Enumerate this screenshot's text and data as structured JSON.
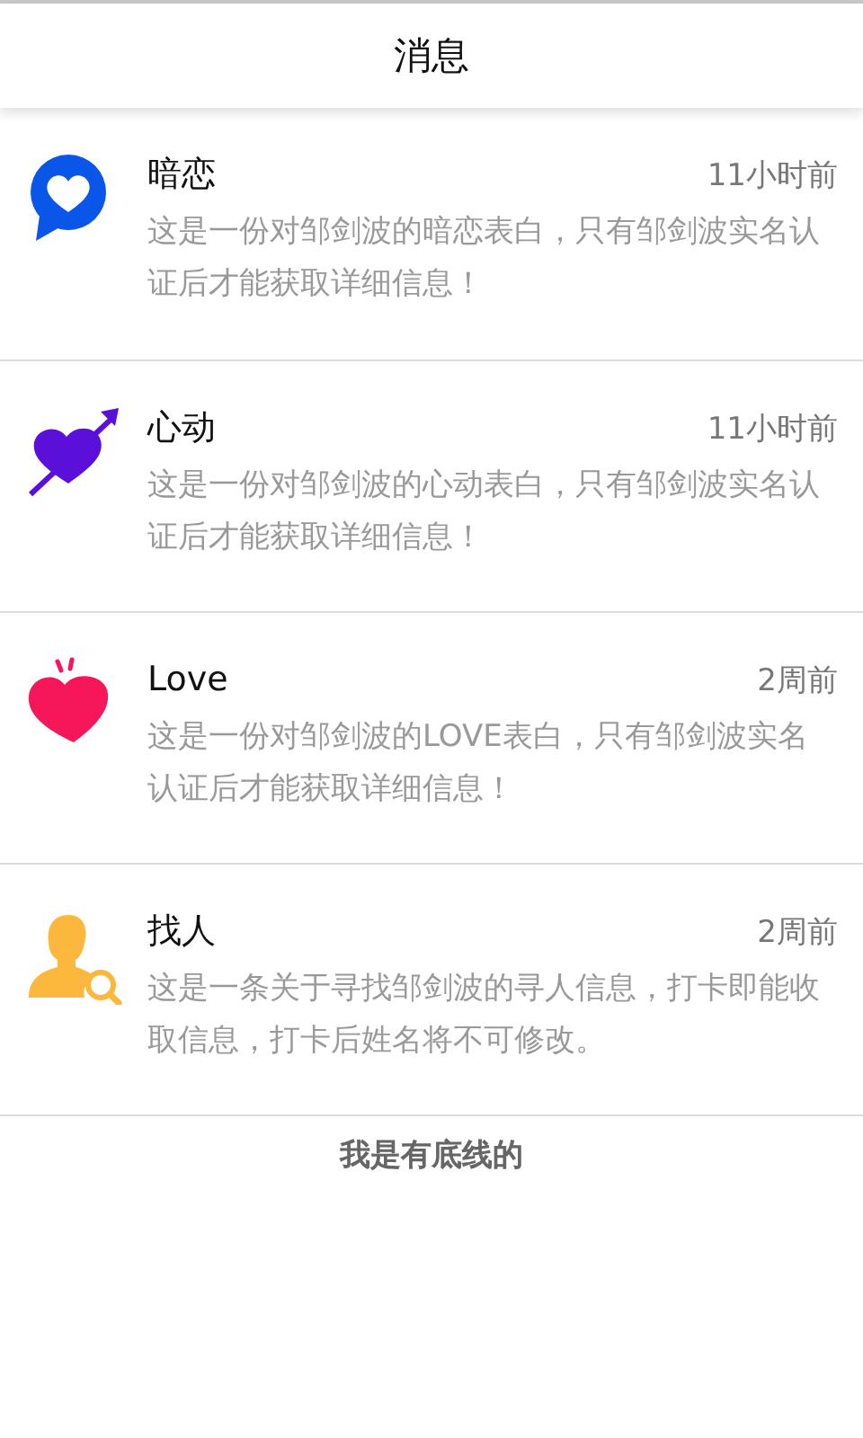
{
  "header": {
    "title": "消息"
  },
  "messages": [
    {
      "kind": "chat-heart",
      "title": "暗恋",
      "time": "11小时前",
      "text": "这是一份对邹剑波的暗恋表白，只有邹剑波实名认证后才能获取详细信息！"
    },
    {
      "kind": "arrow-heart",
      "title": "心动",
      "time": "11小时前",
      "text": "这是一份对邹剑波的心动表白，只有邹剑波实名认证后才能获取详细信息！"
    },
    {
      "kind": "heart",
      "title": "Love",
      "time": "2周前",
      "text": "这是一份对邹剑波的LOVE表白，只有邹剑波实名认证后才能获取详细信息！"
    },
    {
      "kind": "person-search",
      "title": "找人",
      "time": "2周前",
      "text": "这是一条关于寻找邹剑波的寻人信息，打卡即能收取信息，打卡后姓名将不可修改。"
    }
  ],
  "footer": "我是有底线的"
}
